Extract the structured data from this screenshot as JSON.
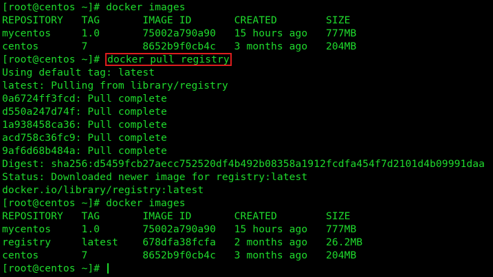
{
  "colors": {
    "background": "#000000",
    "text": "#1fdc2d",
    "highlight_border": "#e01e1e"
  },
  "prompt": "[root@centos ~]# ",
  "lines": [
    "[root@centos ~]# docker images",
    "REPOSITORY   TAG       IMAGE ID       CREATED        SIZE",
    "mycentos     1.0       75002a790a90   15 hours ago   777MB",
    "centos       7         8652b9f0cb4c   3 months ago   204MB"
  ],
  "highlighted_command": "docker pull registry",
  "output": [
    "Using default tag: latest",
    "latest: Pulling from library/registry",
    "0a6724ff3fcd: Pull complete",
    "d550a247d74f: Pull complete",
    "1a938458ca36: Pull complete",
    "acd758c36fc9: Pull complete",
    "9af6d68b484a: Pull complete",
    "Digest: sha256:d5459fcb27aecc752520df4b492b08358a1912fcdfa454f7d2101d4b09991daa",
    "Status: Downloaded newer image for registry:latest",
    "docker.io/library/registry:latest",
    "[root@centos ~]# docker images",
    "REPOSITORY   TAG       IMAGE ID       CREATED        SIZE",
    "mycentos     1.0       75002a790a90   15 hours ago   777MB",
    "registry     latest    678dfa38fcfa   2 months ago   26.2MB",
    "centos       7         8652b9f0cb4c   3 months ago   204MB"
  ],
  "final_prompt": "[root@centos ~]# "
}
